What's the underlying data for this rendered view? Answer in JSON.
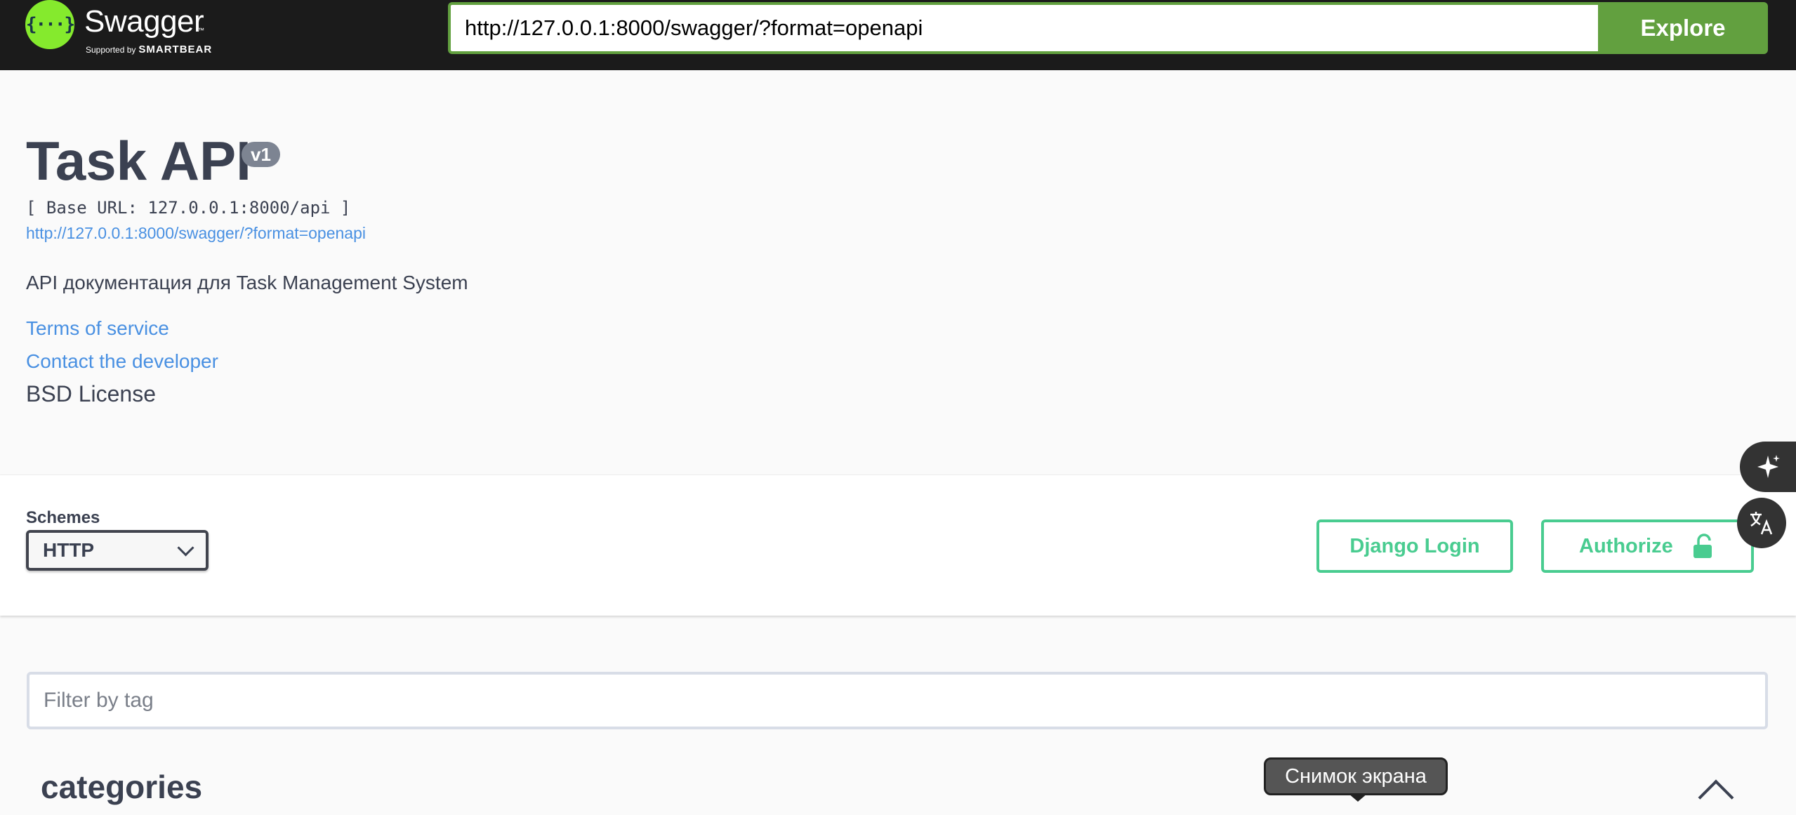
{
  "topbar": {
    "brand_title": "Swagger",
    "brand_tm": "™",
    "brand_supported_by": "Supported by",
    "brand_smartbear": "SMARTBEAR",
    "logo_glyph": "{···}",
    "url_value": "http://127.0.0.1:8000/swagger/?format=openapi",
    "explore_label": "Explore",
    "accent_color": "#85ea2d",
    "explore_color": "#62a03f"
  },
  "info": {
    "title": "Task API",
    "version": "v1",
    "base_url": "[ Base URL: 127.0.0.1:8000/api ]",
    "spec_url": "http://127.0.0.1:8000/swagger/?format=openapi",
    "description": "API документация для Task Management System",
    "terms_label": "Terms of service",
    "contact_label": "Contact the developer",
    "license_label": "BSD License",
    "link_color": "#4990e2"
  },
  "schemes": {
    "label": "Schemes",
    "selected": "HTTP",
    "django_login_label": "Django Login",
    "authorize_label": "Authorize",
    "button_color": "#49cc90"
  },
  "filter": {
    "placeholder": "Filter by tag"
  },
  "tags": [
    {
      "name": "categories"
    }
  ],
  "tooltip": {
    "text": "Снимок экрана"
  },
  "side_buttons": {
    "ai_icon": "sparkle-icon",
    "translate_icon": "translate-icon"
  }
}
